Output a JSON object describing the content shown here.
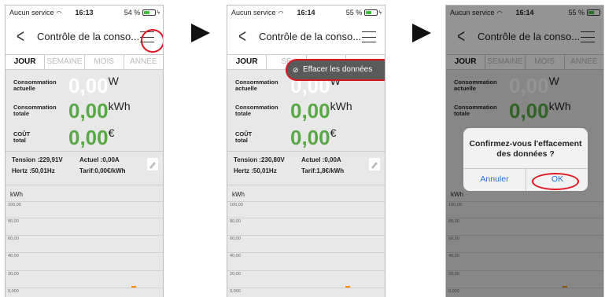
{
  "screens": [
    {
      "status": {
        "carrier": "Aucun service",
        "time": "16:13",
        "battery": "54 %",
        "battery_level": 0.54
      },
      "nav": {
        "title": "Contrôle de la conso..."
      },
      "tabs": [
        "JOUR",
        "SEMAINE",
        "MOIS",
        "ANNEE"
      ],
      "metrics": [
        {
          "label1": "Consommation",
          "label2": "actuelle",
          "value": "0,00",
          "unit": "W"
        },
        {
          "label1": "Consommation",
          "label2": "totale",
          "value": "0,00",
          "unit": "kWh"
        },
        {
          "label1": "COÛT",
          "label2": "total",
          "value": "0,00",
          "unit": "€"
        }
      ],
      "info": {
        "tension": "Tension :229,91V",
        "actuel": "Actuel :0,00A",
        "hertz": "Hertz :50,01Hz",
        "tarif": "Tarif:0,00€/kWh"
      },
      "chart": {
        "unit": "kWh",
        "yticks": [
          "100,00",
          "80,00",
          "60,00",
          "40,00",
          "20,00",
          "0,000"
        ]
      }
    },
    {
      "status": {
        "carrier": "Aucun service",
        "time": "16:14",
        "battery": "55 %",
        "battery_level": 0.55
      },
      "nav": {
        "title": "Contrôle de la conso..."
      },
      "tabs": [
        "JOUR",
        "SE",
        "",
        ""
      ],
      "metrics": [
        {
          "label1": "Consommation",
          "label2": "actuelle",
          "value": "0,00",
          "unit": "W"
        },
        {
          "label1": "Consommation",
          "label2": "totale",
          "value": "0,00",
          "unit": "kWh"
        },
        {
          "label1": "COÛT",
          "label2": "total",
          "value": "0,00",
          "unit": "€"
        }
      ],
      "info": {
        "tension": "Tension :230,80V",
        "actuel": "Actuel :0,00A",
        "hertz": "Hertz :50,01Hz",
        "tarif": "Tarif:1,8€/kWh"
      },
      "chart": {
        "unit": "kWh",
        "yticks": [
          "100,00",
          "80,00",
          "60,00",
          "40,00",
          "20,00",
          "0,000"
        ]
      },
      "menu": {
        "clear_data": "Effacer les données"
      }
    },
    {
      "status": {
        "carrier": "Aucun service",
        "time": "16:14",
        "battery": "55 %",
        "battery_level": 0.55
      },
      "nav": {
        "title": "Contrôle de la conso..."
      },
      "tabs": [
        "JOUR",
        "SEMAINE",
        "MOIS",
        "ANNEE"
      ],
      "metrics": [
        {
          "label1": "Consommation",
          "label2": "actuelle",
          "value": "0,00",
          "unit": "W"
        },
        {
          "label1": "Consommation",
          "label2": "totale",
          "value": "0,00",
          "unit": "kWh"
        }
      ],
      "chart": {
        "unit": "kWh",
        "yticks": [
          "100,00",
          "80,00",
          "60,00",
          "40,00",
          "20,00",
          "0,000"
        ]
      },
      "dialog": {
        "message1": "Confirmez-vous l'effacement",
        "message2": "des données ?",
        "cancel": "Annuler",
        "ok": "OK"
      }
    }
  ],
  "colors": {
    "accent_green": "#58a946",
    "highlight_red": "#e0141e",
    "ios_blue": "#2a6fd8",
    "bar_orange": "#ff8a00"
  }
}
